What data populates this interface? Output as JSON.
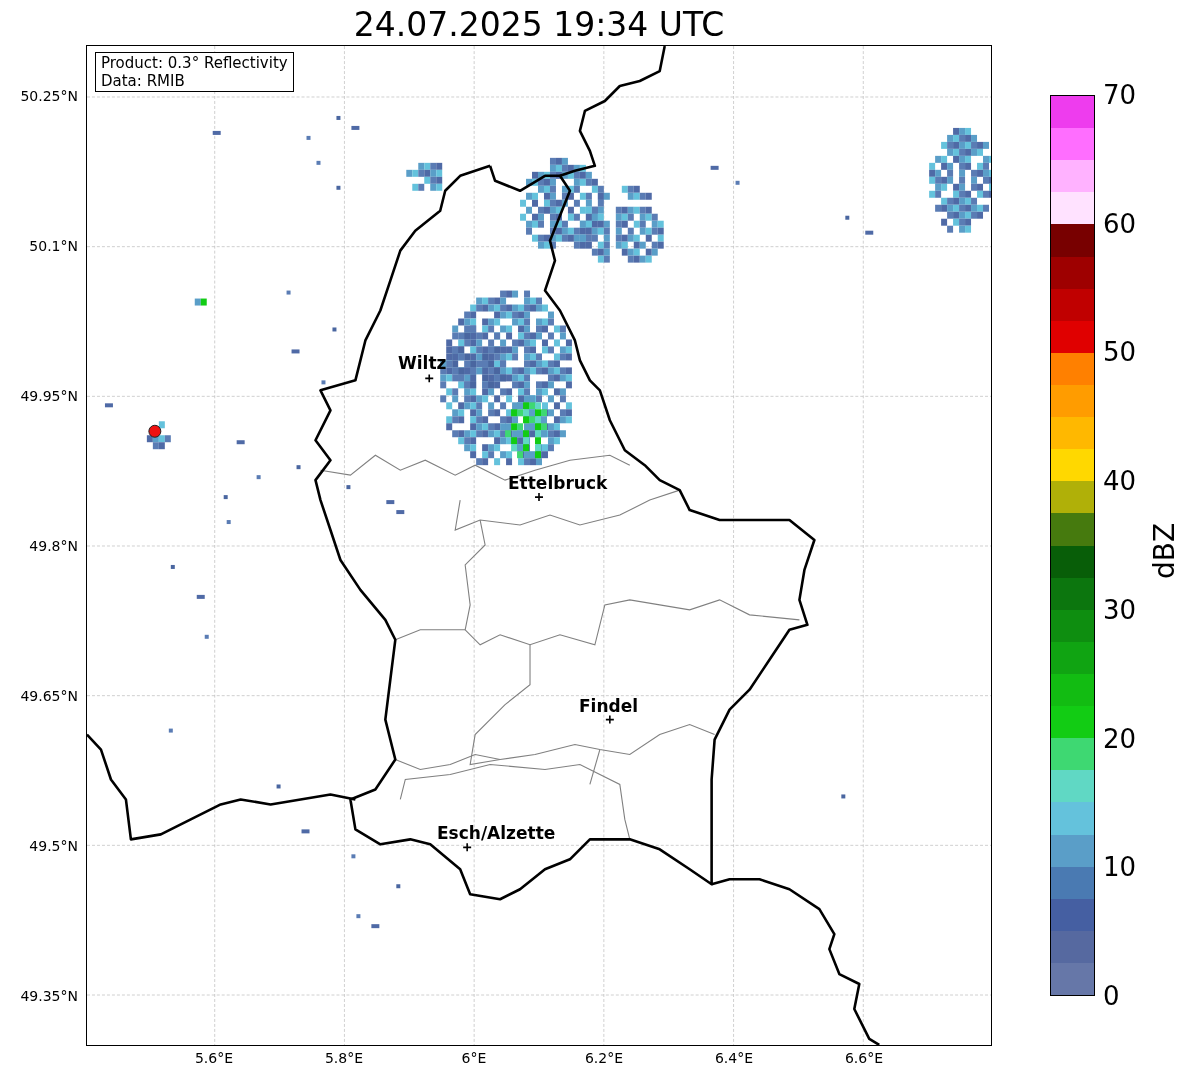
{
  "title": "24.07.2025 19:34 UTC",
  "info_box": [
    "Product: 0.3° Reflectivity",
    "Data: RMIB"
  ],
  "map": {
    "y_ticks": [
      "50.25°N",
      "50.1°N",
      "49.95°N",
      "49.8°N",
      "49.65°N",
      "49.5°N",
      "49.35°N"
    ],
    "x_ticks": [
      "5.6°E",
      "5.8°E",
      "6°E",
      "6.2°E",
      "6.4°E",
      "6.6°E"
    ],
    "cities": [
      {
        "name": "Wiltz"
      },
      {
        "name": "Ettelbruck"
      },
      {
        "name": "Findel"
      },
      {
        "name": "Esch/Alzette"
      }
    ]
  },
  "colorbar": {
    "label": "dBZ",
    "ticks": [
      "70",
      "60",
      "50",
      "40",
      "30",
      "20",
      "10",
      "0"
    ],
    "colors": [
      {
        "color": "#ee3cee"
      },
      {
        "color": "#ff6eff"
      },
      {
        "color": "#ffb2ff"
      },
      {
        "color": "#ffe2ff"
      },
      {
        "color": "#780000"
      },
      {
        "color": "#9e0000"
      },
      {
        "color": "#c00000"
      },
      {
        "color": "#e00000"
      },
      {
        "color": "#ff8000"
      },
      {
        "color": "#ff9c00"
      },
      {
        "color": "#ffb800"
      },
      {
        "color": "#ffd800"
      },
      {
        "color": "#b0b008"
      },
      {
        "color": "#467a0e"
      },
      {
        "color": "#085e08"
      },
      {
        "color": "#0c760e"
      },
      {
        "color": "#0e8e10"
      },
      {
        "color": "#10a412"
      },
      {
        "color": "#12bc12"
      },
      {
        "color": "#12cc14"
      },
      {
        "color": "#3ed872"
      },
      {
        "color": "#60d8c4"
      },
      {
        "color": "#64c2dc"
      },
      {
        "color": "#5a9ec8"
      },
      {
        "color": "#4a7ab2"
      },
      {
        "color": "#455fa2"
      },
      {
        "color": "#5669a0"
      },
      {
        "color": "#6677a8"
      }
    ]
  }
}
